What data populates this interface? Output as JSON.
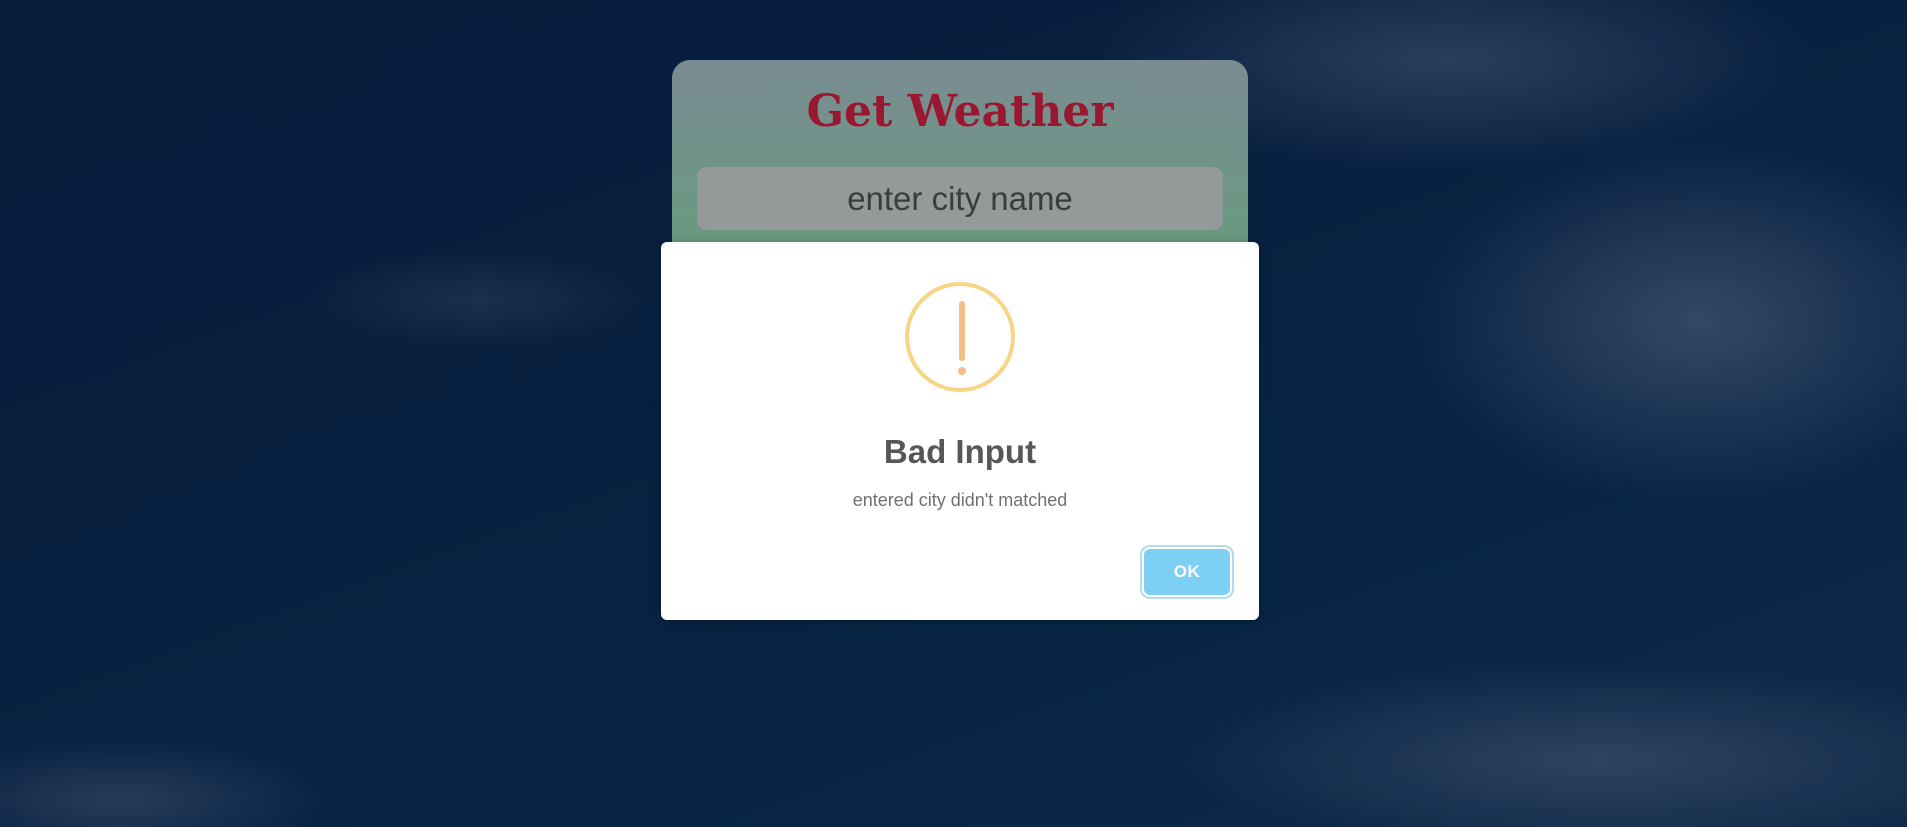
{
  "app": {
    "title": "Get Weather"
  },
  "search": {
    "placeholder": "enter city name",
    "value": ""
  },
  "alert": {
    "icon": "warning-exclamation-icon",
    "title": "Bad Input",
    "message": "entered city didn't matched",
    "ok_label": "OK"
  },
  "colors": {
    "title": "#9a1730",
    "warning_icon": "#f8d486",
    "ok_button": "#7ecff4"
  }
}
